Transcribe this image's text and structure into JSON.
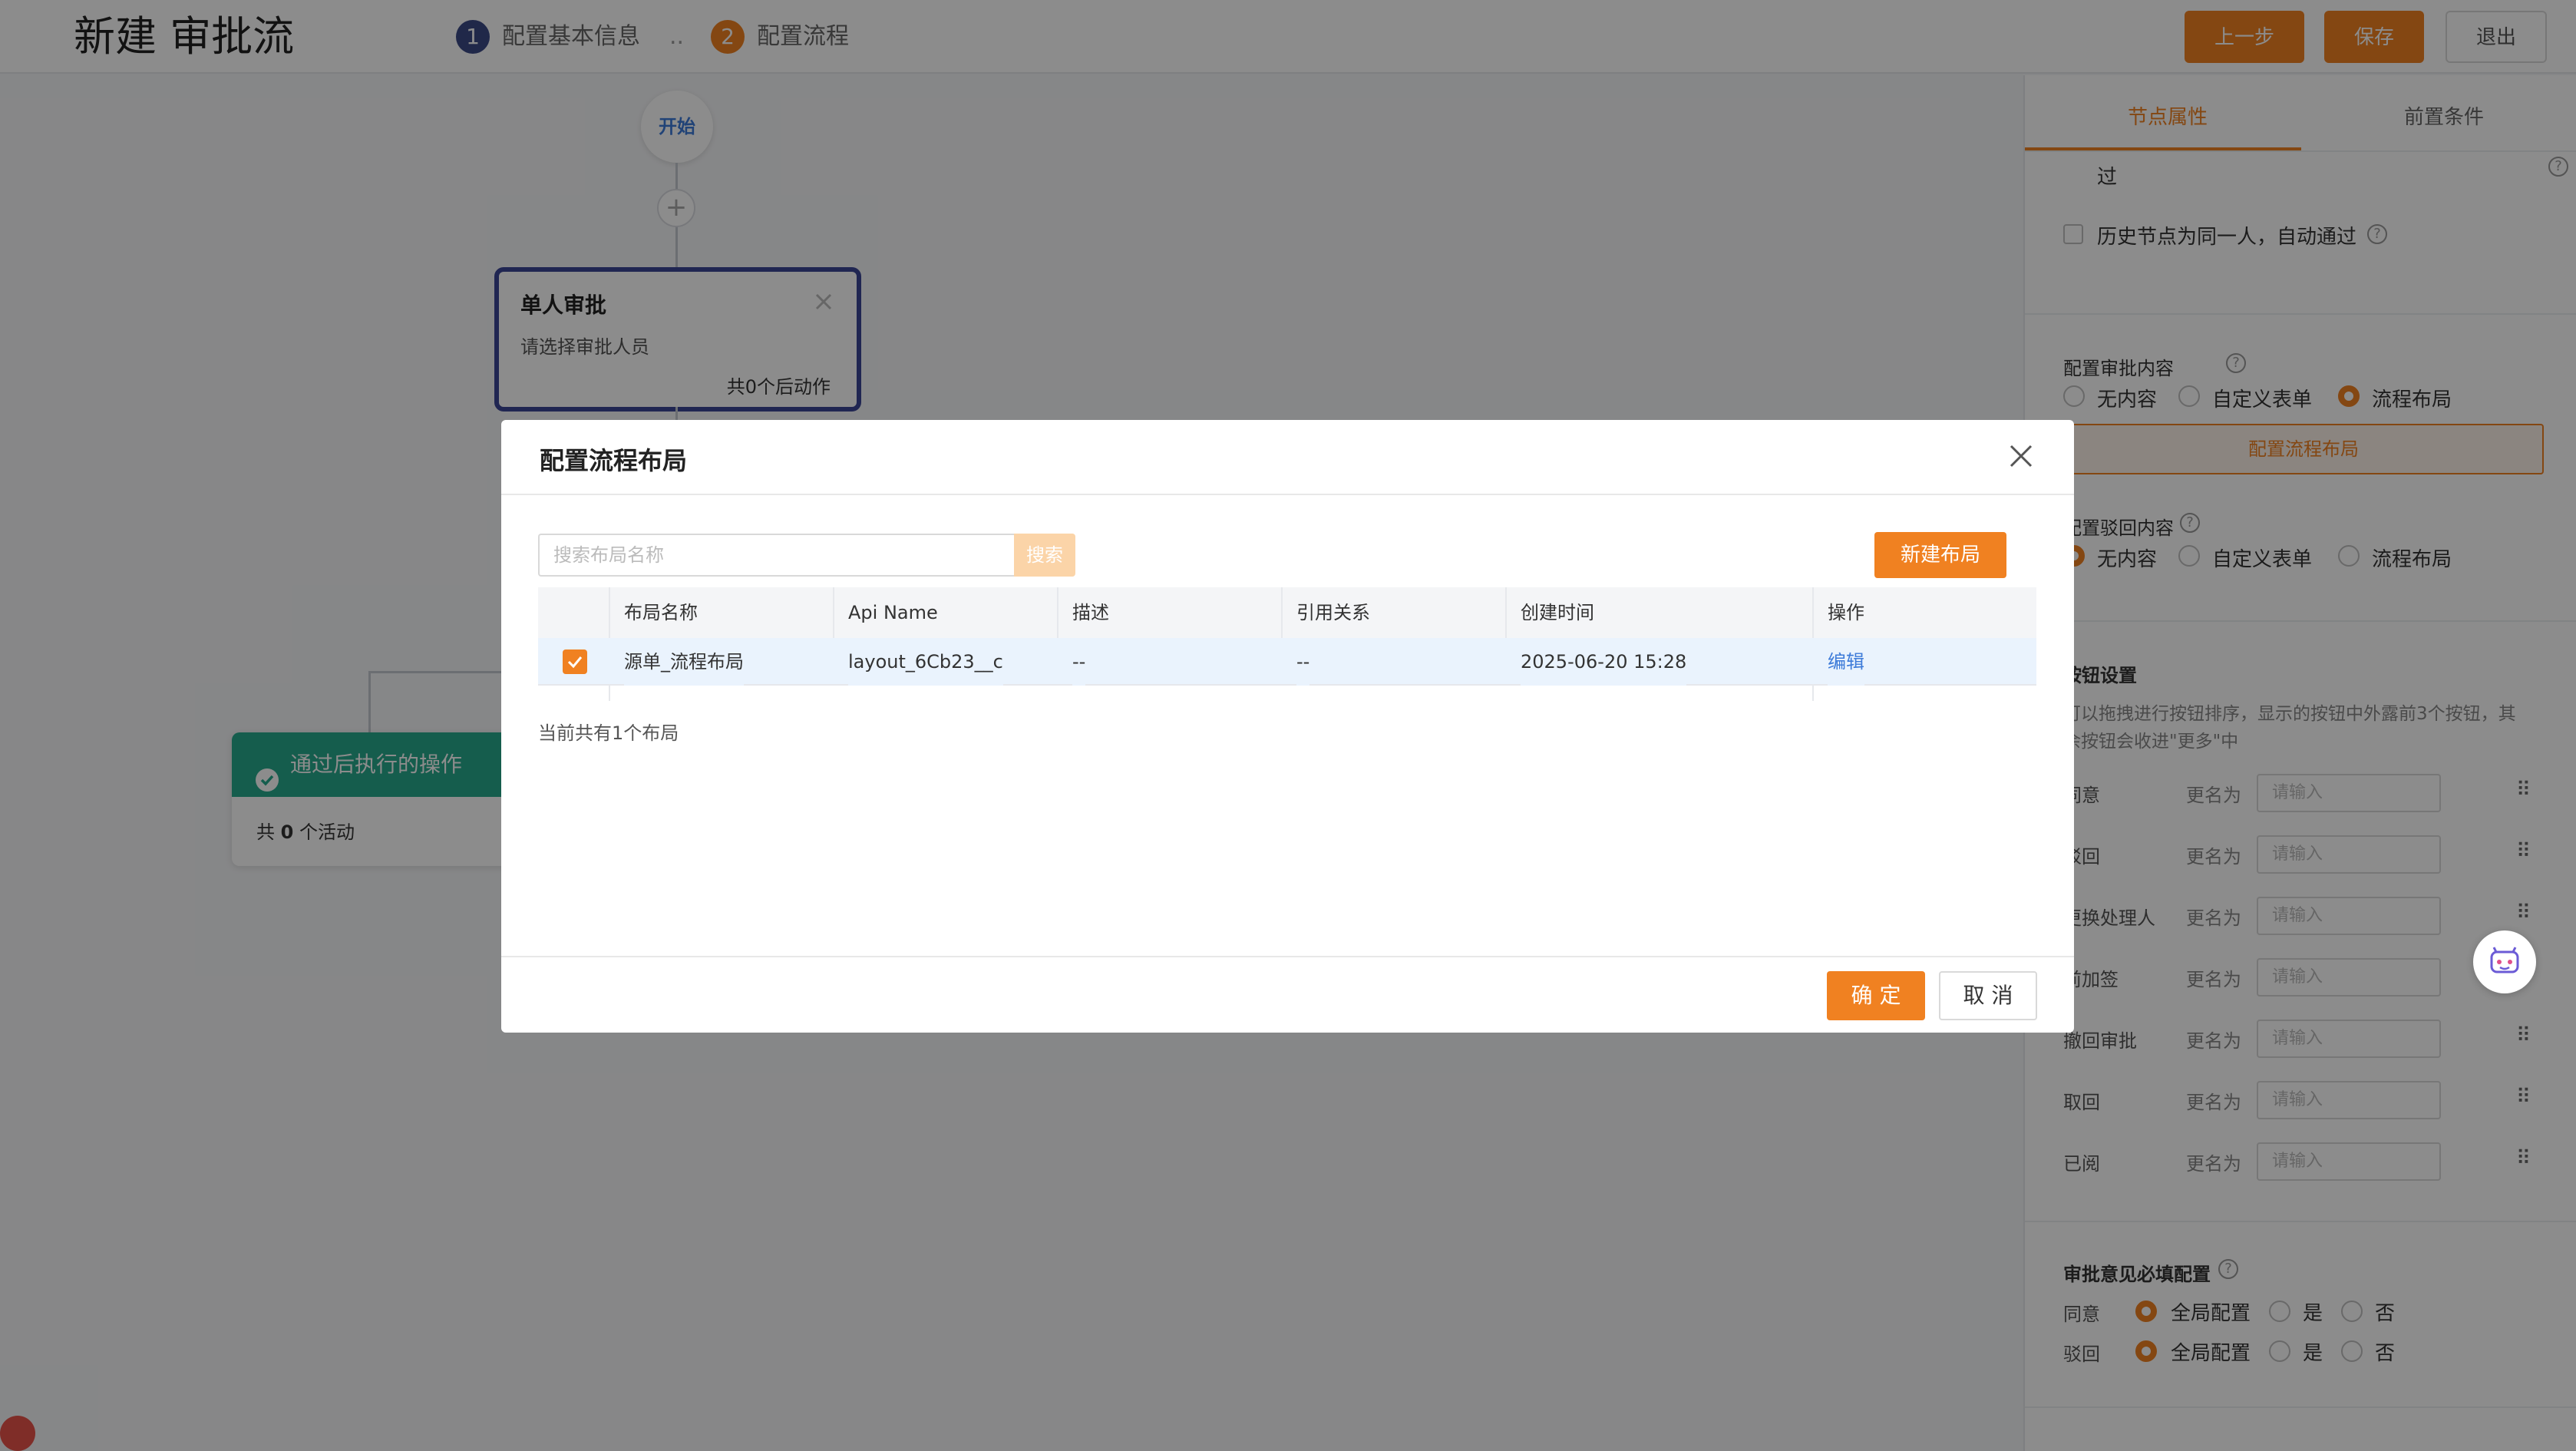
{
  "header": {
    "title": "新建 审批流",
    "steps": [
      {
        "num": "1",
        "label": "配置基本信息"
      },
      {
        "num": "2",
        "label": "配置流程"
      }
    ],
    "step_separator": "..",
    "buttons": {
      "prev": "上一步",
      "save": "保存",
      "exit": "退出"
    }
  },
  "canvas": {
    "start_label": "开始",
    "add_symbol": "+",
    "node": {
      "title": "单人审批",
      "subtitle": "请选择审批人员",
      "footer": "共0个后动作"
    },
    "green_card": {
      "title": "通过后执行的操作",
      "count_prefix": "共 ",
      "count": "0",
      "count_suffix": " 个活动"
    }
  },
  "panel": {
    "tabs": [
      "节点属性",
      "前置条件"
    ],
    "partial_text": "过",
    "history_same": "历史节点为同一人，自动通过",
    "approval_content": {
      "title": "配置审批内容",
      "options": [
        "无内容",
        "自定义表单",
        "流程布局"
      ],
      "selected": 2,
      "config_button": "配置流程布局"
    },
    "reject_content": {
      "title": "配置驳回内容",
      "options": [
        "无内容",
        "自定义表单",
        "流程布局"
      ],
      "selected": 0
    },
    "button_settings": {
      "title": "按钮设置",
      "desc_line1": "可以拖拽进行按钮排序，显示的按钮中外露前3个按钮，其",
      "desc_line2": "余按钮会收进\"更多\"中",
      "rename_label": "更名为",
      "placeholder": "请输入",
      "rows": [
        "同意",
        "驳回",
        "更换处理人",
        "前加签",
        "撤回审批",
        "取回",
        "已阅"
      ]
    },
    "opinion": {
      "title": "审批意见必填配置",
      "rows": [
        {
          "label": "同意",
          "options": [
            "全局配置",
            "是",
            "否"
          ],
          "selected": 0
        },
        {
          "label": "驳回",
          "options": [
            "全局配置",
            "是",
            "否"
          ],
          "selected": 0
        }
      ]
    }
  },
  "modal": {
    "title": "配置流程布局",
    "search_placeholder": "搜索布局名称",
    "search_button": "搜索",
    "new_button": "新建布局",
    "columns": [
      "布局名称",
      "Api Name",
      "描述",
      "引用关系",
      "创建时间",
      "操作"
    ],
    "rows": [
      {
        "name": "源单_流程布局",
        "api": "layout_6Cb23__c",
        "desc": "--",
        "ref": "--",
        "created": "2025-06-20 15:28",
        "action": "编辑",
        "checked": true
      }
    ],
    "summary": "当前共有1个布局",
    "ok": "确 定",
    "cancel": "取 消"
  },
  "colors": {
    "accent": "#f08121",
    "link": "#3d7bd9",
    "green": "#27a98c",
    "step1": "#3b4a86"
  },
  "icons": [
    "close-icon",
    "check-icon",
    "help-icon",
    "drag-handle-icon",
    "robot-assistant-icon",
    "success-check-icon"
  ]
}
